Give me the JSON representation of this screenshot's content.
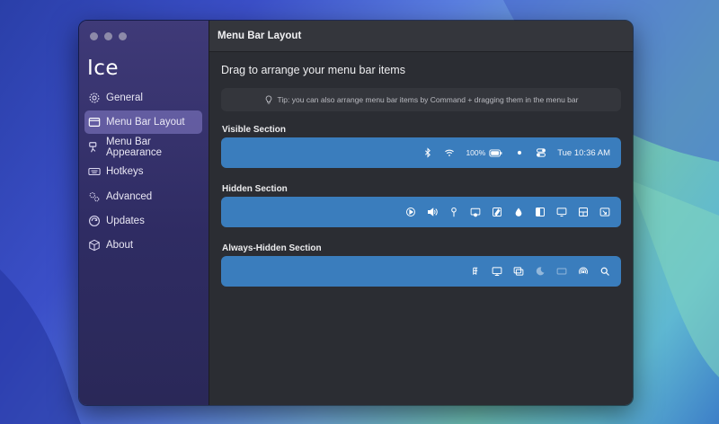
{
  "app": {
    "title": "Ice"
  },
  "window": {
    "title": "Menu Bar Layout"
  },
  "sidebar": {
    "items": [
      {
        "label": "General",
        "icon": "gear-icon",
        "active": false
      },
      {
        "label": "Menu Bar Layout",
        "icon": "menubar-layout-icon",
        "active": true
      },
      {
        "label": "Menu Bar Appearance",
        "icon": "paintbrush-icon",
        "active": false
      },
      {
        "label": "Hotkeys",
        "icon": "keyboard-icon",
        "active": false
      },
      {
        "label": "Advanced",
        "icon": "gears-icon",
        "active": false
      },
      {
        "label": "Updates",
        "icon": "refresh-icon",
        "active": false
      },
      {
        "label": "About",
        "icon": "cube-icon",
        "active": false
      }
    ]
  },
  "main": {
    "heading": "Drag to arrange your menu bar items",
    "tip": "Tip: you can also arrange menu bar items by Command + dragging them in the menu bar",
    "sections": {
      "visible": {
        "label": "Visible Section",
        "items": [
          "bluetooth-icon",
          "wifi-icon",
          "battery-icon",
          "dot-icon",
          "control-center-icon"
        ],
        "battery_percent": "100%",
        "clock": "Tue 10:36 AM"
      },
      "hidden": {
        "label": "Hidden Section",
        "items": [
          "play-icon",
          "volume-icon",
          "pin-icon",
          "screen-record-icon",
          "pen-icon",
          "drop-icon",
          "sidebar-icon",
          "display-icon",
          "grid-icon",
          "screen-share-icon"
        ]
      },
      "always_hidden": {
        "label": "Always-Hidden Section",
        "items": [
          "keypad-icon",
          "monitor-icon",
          "window-stack-icon",
          "moon-icon",
          "rect-icon",
          "airdrop-icon",
          "search-icon"
        ]
      }
    }
  },
  "colors": {
    "accent_bar": "#3a7dbd",
    "sidebar": "#2f2c63",
    "main_bg": "#2b2d33"
  }
}
